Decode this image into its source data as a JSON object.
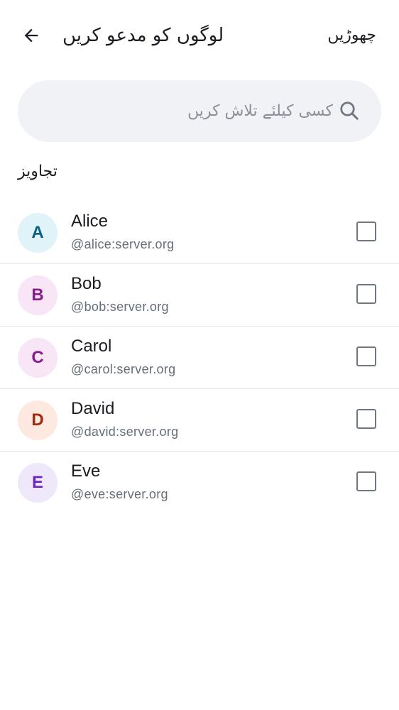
{
  "header": {
    "title": "لوگوں کو مدعو کریں",
    "skip_label": "چھوڑیں",
    "back_icon": "arrow-left-icon"
  },
  "search": {
    "placeholder": "کسی کیلئے تلاش کریں",
    "value": "",
    "icon": "search-icon"
  },
  "suggestions": {
    "header": "تجاویز",
    "items": [
      {
        "initial": "A",
        "name": "Alice",
        "handle": "@alice:server.org",
        "checked": false,
        "avatar_bg": "#e0f3f8",
        "avatar_fg": "#0b5e85"
      },
      {
        "initial": "B",
        "name": "Bob",
        "handle": "@bob:server.org",
        "checked": false,
        "avatar_bg": "#f8e6f6",
        "avatar_fg": "#8a1b8a"
      },
      {
        "initial": "C",
        "name": "Carol",
        "handle": "@carol:server.org",
        "checked": false,
        "avatar_bg": "#f8e6f6",
        "avatar_fg": "#8a1b8a"
      },
      {
        "initial": "D",
        "name": "David",
        "handle": "@david:server.org",
        "checked": false,
        "avatar_bg": "#fde9df",
        "avatar_fg": "#a32a0f"
      },
      {
        "initial": "E",
        "name": "Eve",
        "handle": "@eve:server.org",
        "checked": false,
        "avatar_bg": "#efe8fb",
        "avatar_fg": "#6a2ac0"
      }
    ]
  },
  "colors": {
    "background": "#ffffff",
    "search_bg": "#f0f2f5",
    "text_primary": "#1b1d22",
    "text_secondary": "#656d77",
    "divider": "#e6e8eb",
    "checkbox_border": "#6f7680"
  }
}
